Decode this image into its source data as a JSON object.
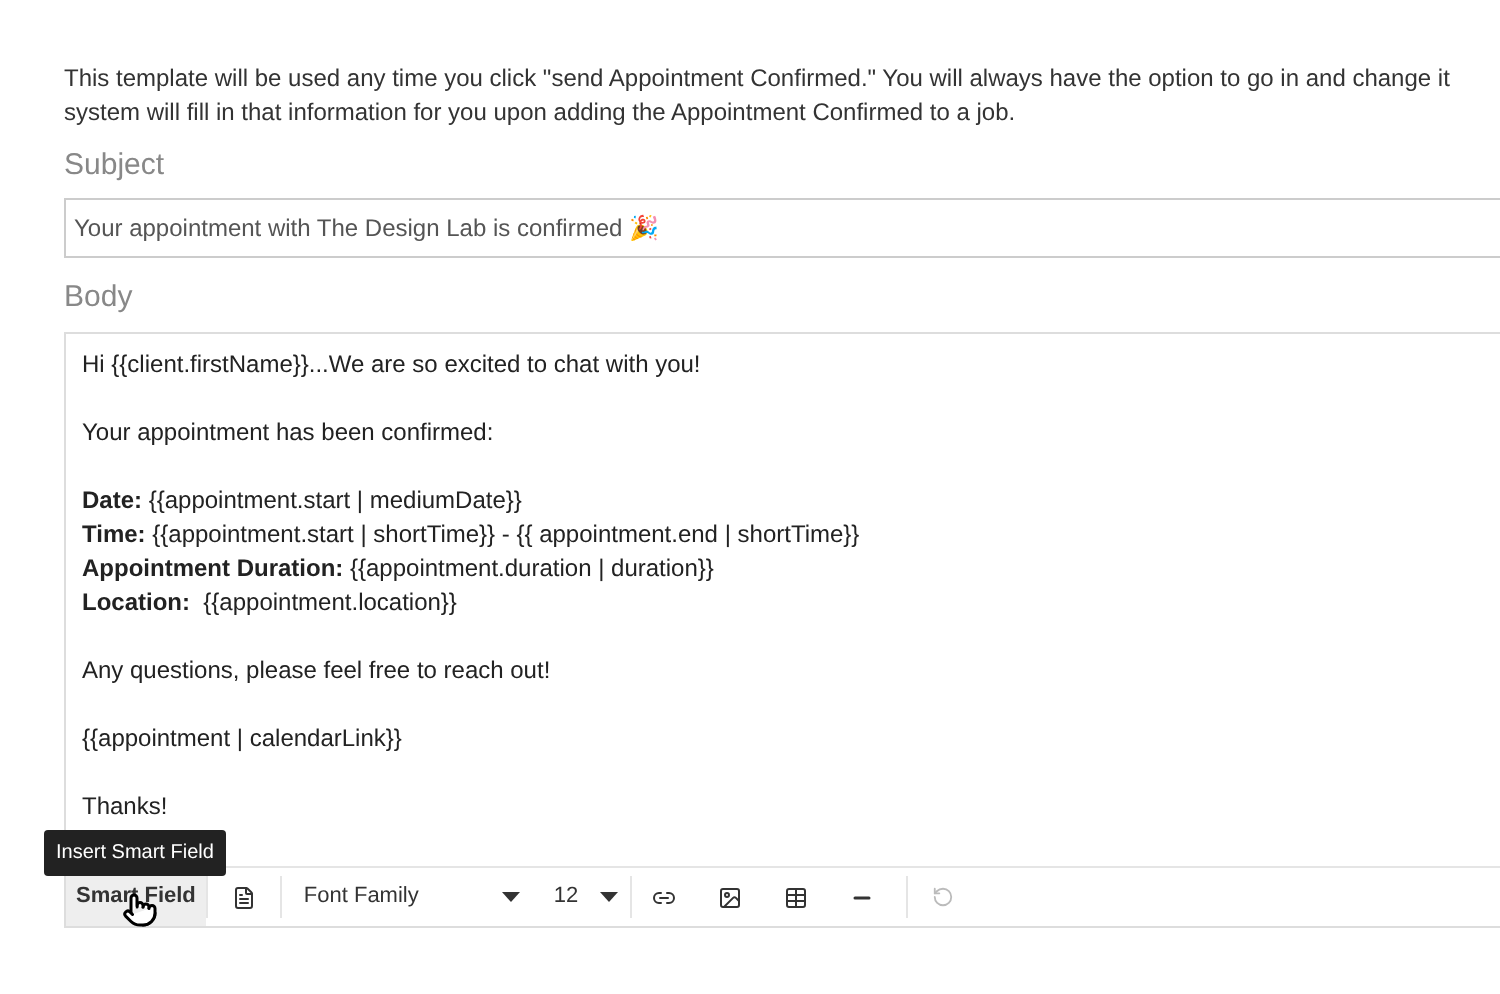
{
  "intro": "This template will be used any time you click \"send Appointment Confirmed.\" You will always have the option to go in and change it system will fill in that information for you upon adding the Appointment Confirmed to a job.",
  "subject": {
    "label": "Subject",
    "value": "Your appointment with The Design Lab is confirmed 🎉"
  },
  "body": {
    "label": "Body",
    "paragraphs": [
      [
        "Hi {{client.firstName}}...We are so excited to chat with you!"
      ],
      [
        "Your appointment has been confirmed:"
      ],
      [
        "**Date:** {{appointment.start | mediumDate}}",
        "**Time:** {{appointment.start | shortTime}} - {{ appointment.end | shortTime}}",
        "**Appointment Duration:** {{appointment.duration | duration}}",
        "**Location:**  {{appointment.location}}"
      ],
      [
        "Any questions, please feel free to reach out!"
      ],
      [
        "{{appointment | calendarLink}}"
      ],
      [
        "Thanks!"
      ]
    ]
  },
  "toolbar": {
    "smart_field": {
      "label": "Smart Field",
      "selected": true
    },
    "tooltip": "Insert Smart Field",
    "font_family": "Font Family",
    "font_size": "12",
    "undo_disabled": true
  }
}
